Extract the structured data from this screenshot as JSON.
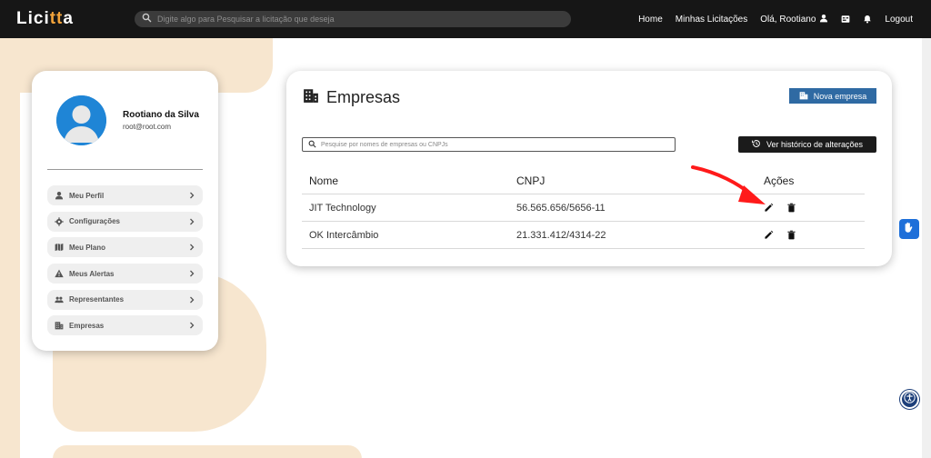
{
  "app": {
    "logo_prefix": "Lici",
    "logo_accent": "tt",
    "logo_suffix": "a",
    "accent_color": "#f2a33a"
  },
  "topbar": {
    "search_placeholder": "Digite algo para Pesquisar a licitação que deseja",
    "home": "Home",
    "my_bids": "Minhas Licitações",
    "greeting": "Olá, Rootiano",
    "logout": "Logout"
  },
  "profile": {
    "name": "Rootiano da Silva",
    "email": "root@root.com",
    "menu": [
      {
        "label": "Meu Perfil",
        "icon": "user-icon"
      },
      {
        "label": "Configurações",
        "icon": "gear-icon"
      },
      {
        "label": "Meu Plano",
        "icon": "map-icon"
      },
      {
        "label": "Meus Alertas",
        "icon": "warning-icon"
      },
      {
        "label": "Representantes",
        "icon": "people-icon"
      },
      {
        "label": "Empresas",
        "icon": "building-icon"
      }
    ]
  },
  "empresas": {
    "title": "Empresas",
    "new_button": "Nova empresa",
    "search_placeholder": "Pesquise por nomes de empresas ou CNPJs",
    "history_button": "Ver histórico de alterações",
    "columns": [
      "Nome",
      "CNPJ",
      "Ações"
    ],
    "rows": [
      {
        "nome": "JIT Technology",
        "cnpj": "56.565.656/5656-11"
      },
      {
        "nome": "OK Intercâmbio",
        "cnpj": "21.331.412/4314-22"
      }
    ]
  },
  "colors": {
    "topbar": "#161616",
    "primary_button": "#2f6aa3",
    "dark_button": "#1b1b1b",
    "background_decoration": "#f7e6cf",
    "arrow": "#ff1a1a"
  }
}
